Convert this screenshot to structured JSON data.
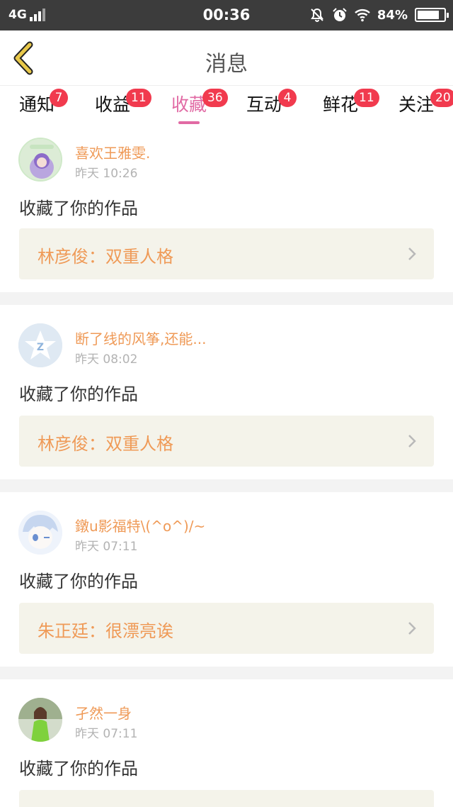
{
  "status_bar": {
    "network": "4G",
    "time": "00:36",
    "battery_percent": "84%",
    "battery_level": 0.84,
    "icons": [
      "signal-icon",
      "mute-bell-icon",
      "alarm-icon",
      "wifi-icon",
      "battery-icon"
    ]
  },
  "header": {
    "title": "消息",
    "back_icon": "chevron-left-icon",
    "accent": "#e8c84a"
  },
  "tabs": [
    {
      "label": "通知",
      "badge": "7"
    },
    {
      "label": "收益",
      "badge": "11"
    },
    {
      "label": "收藏",
      "badge": "36",
      "active": true
    },
    {
      "label": "互动",
      "badge": "4"
    },
    {
      "label": "鲜花",
      "badge": "11"
    },
    {
      "label": "关注",
      "badge": "20"
    }
  ],
  "colors": {
    "active_tab": "#e16aa4",
    "badge": "#f13a4e",
    "username": "#ef9a57",
    "work_box_bg": "#f4f3ea"
  },
  "feed": [
    {
      "username": "喜欢王雅雯.",
      "time": "昨天 10:26",
      "action": "收藏了你的作品",
      "work": "林彦俊：双重人格",
      "avatar": "anime-girl-avatar"
    },
    {
      "username": "断了线的风筝,还能...",
      "time": "昨天 08:02",
      "action": "收藏了你的作品",
      "work": "林彦俊：双重人格",
      "avatar": "default-star-avatar"
    },
    {
      "username": "鐓u影福特\\(^o^)/~",
      "time": "昨天 07:11",
      "action": "收藏了你的作品",
      "work": "朱正廷：很漂亮诶",
      "avatar": "anime-boy-avatar"
    },
    {
      "username": "孑然一身",
      "time": "昨天 07:11",
      "action": "收藏了你的作品",
      "work": "",
      "avatar": "photo-avatar"
    }
  ]
}
